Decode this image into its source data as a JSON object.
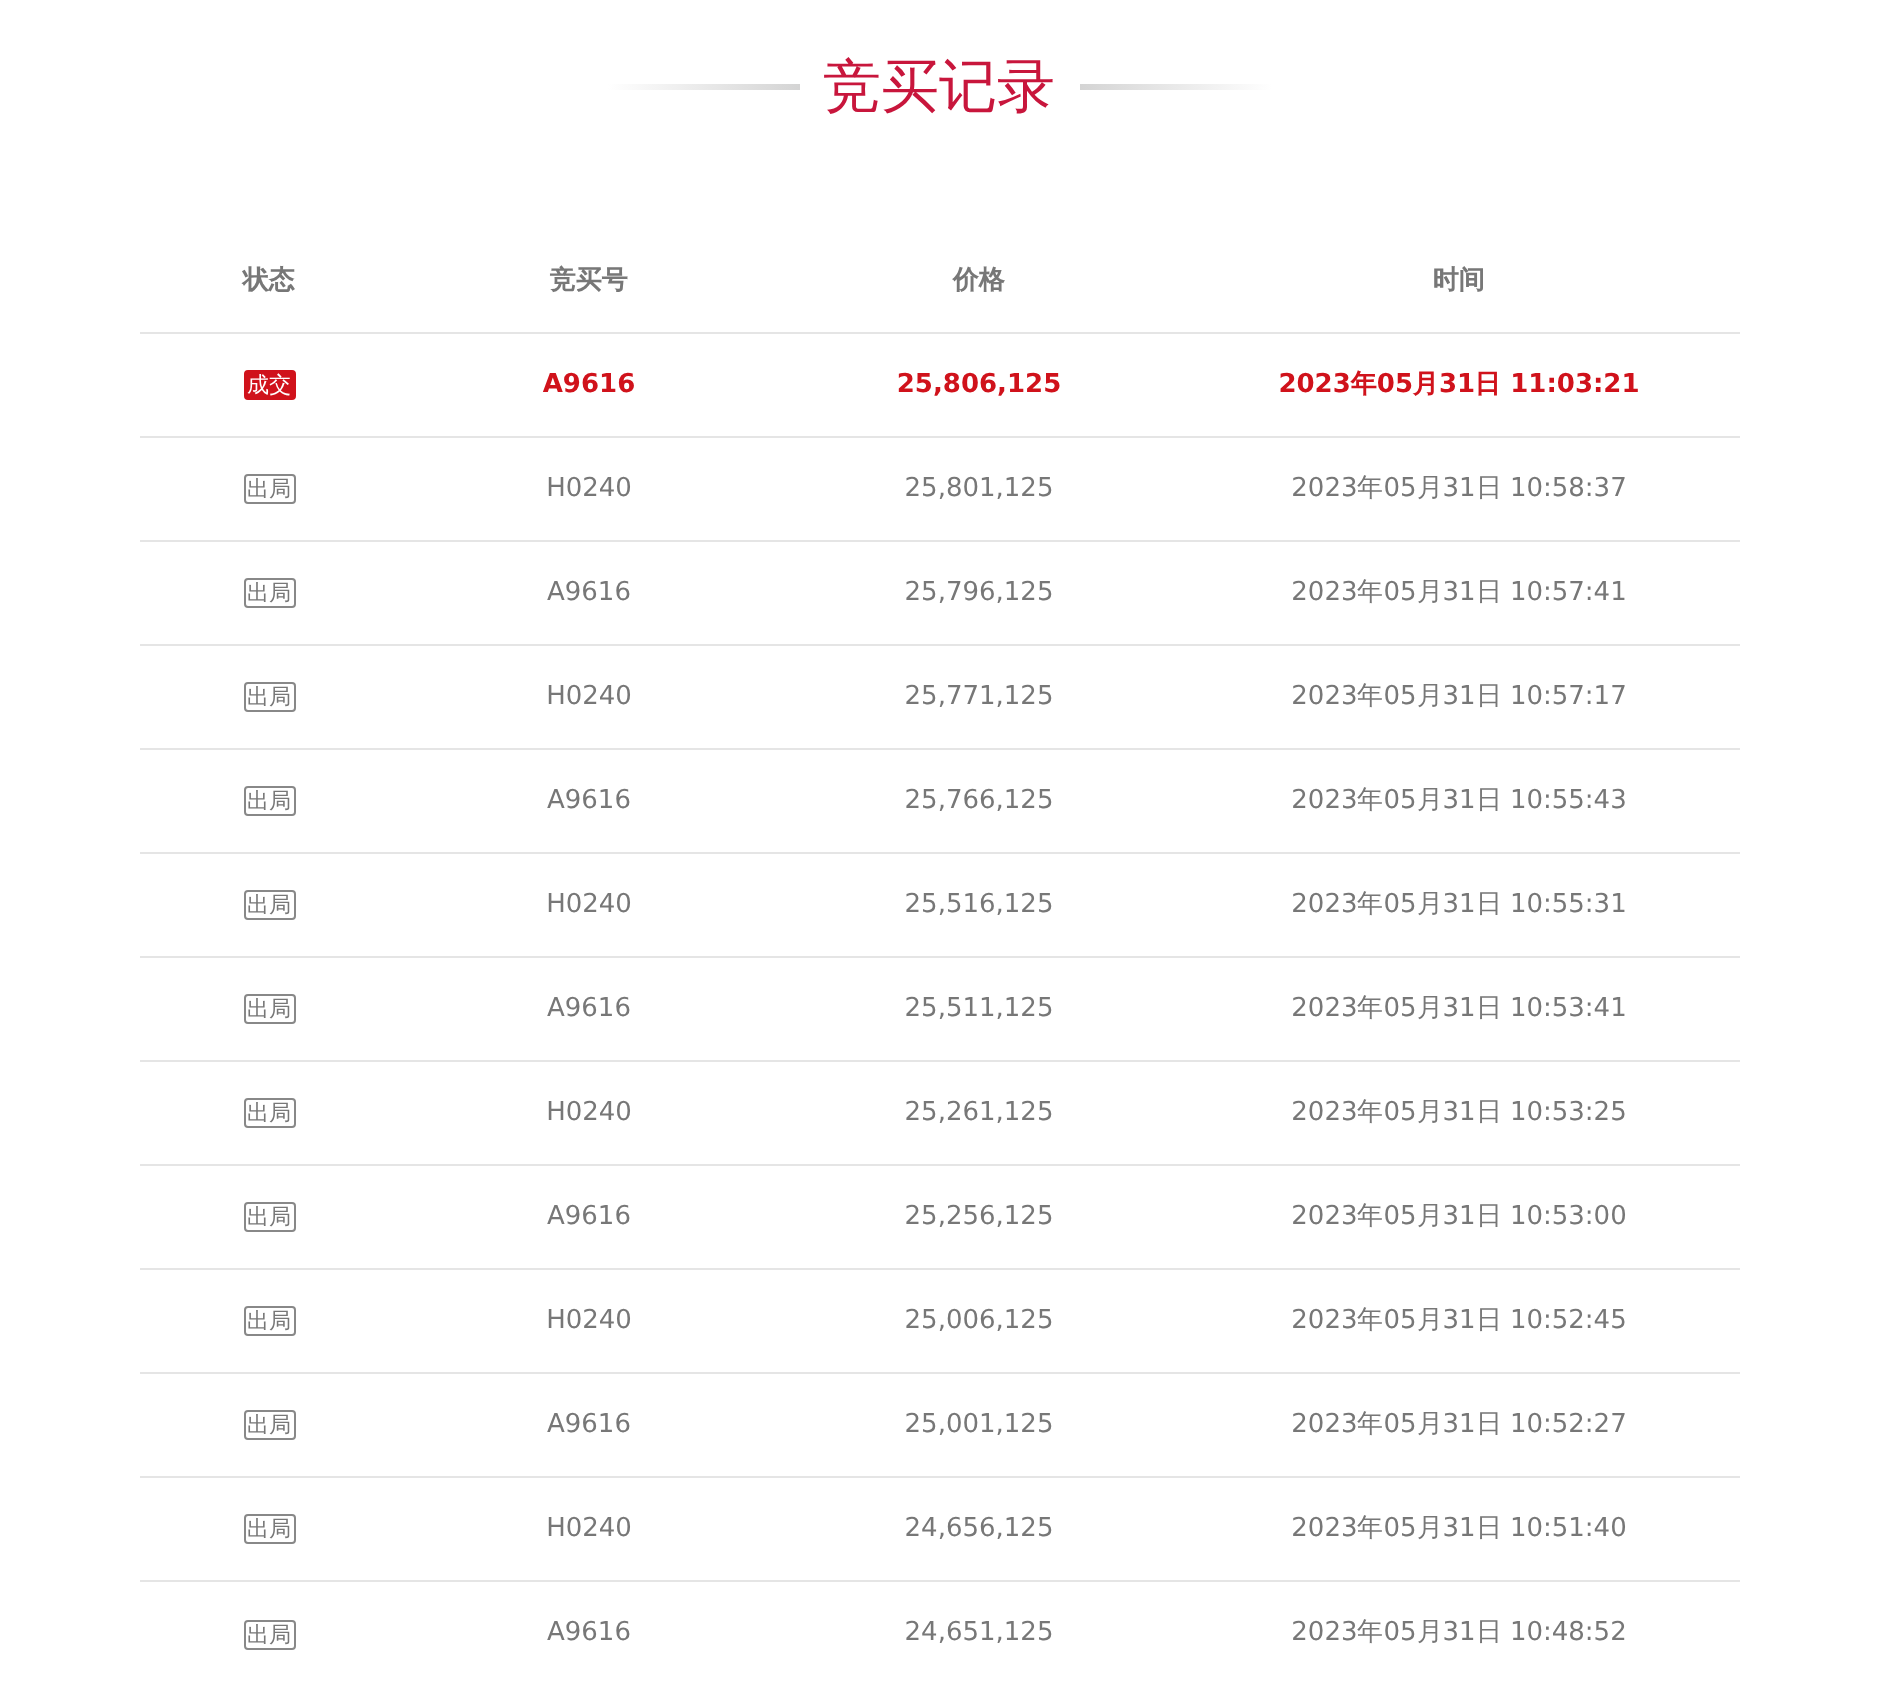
{
  "title": "竞买记录",
  "table": {
    "columns": [
      "状态",
      "竞买号",
      "价格",
      "时间"
    ],
    "rows": [
      {
        "kind": "deal",
        "status": "成交",
        "bidder": "A9616",
        "price": "25,806,125",
        "time": "2023年05月31日 11:03:21"
      },
      {
        "kind": "out",
        "status": "出局",
        "bidder": "H0240",
        "price": "25,801,125",
        "time": "2023年05月31日 10:58:37"
      },
      {
        "kind": "out",
        "status": "出局",
        "bidder": "A9616",
        "price": "25,796,125",
        "time": "2023年05月31日 10:57:41"
      },
      {
        "kind": "out",
        "status": "出局",
        "bidder": "H0240",
        "price": "25,771,125",
        "time": "2023年05月31日 10:57:17"
      },
      {
        "kind": "out",
        "status": "出局",
        "bidder": "A9616",
        "price": "25,766,125",
        "time": "2023年05月31日 10:55:43"
      },
      {
        "kind": "out",
        "status": "出局",
        "bidder": "H0240",
        "price": "25,516,125",
        "time": "2023年05月31日 10:55:31"
      },
      {
        "kind": "out",
        "status": "出局",
        "bidder": "A9616",
        "price": "25,511,125",
        "time": "2023年05月31日 10:53:41"
      },
      {
        "kind": "out",
        "status": "出局",
        "bidder": "H0240",
        "price": "25,261,125",
        "time": "2023年05月31日 10:53:25"
      },
      {
        "kind": "out",
        "status": "出局",
        "bidder": "A9616",
        "price": "25,256,125",
        "time": "2023年05月31日 10:53:00"
      },
      {
        "kind": "out",
        "status": "出局",
        "bidder": "H0240",
        "price": "25,006,125",
        "time": "2023年05月31日 10:52:45"
      },
      {
        "kind": "out",
        "status": "出局",
        "bidder": "A9616",
        "price": "25,001,125",
        "time": "2023年05月31日 10:52:27"
      },
      {
        "kind": "out",
        "status": "出局",
        "bidder": "H0240",
        "price": "24,656,125",
        "time": "2023年05月31日 10:51:40"
      },
      {
        "kind": "out",
        "status": "出局",
        "bidder": "A9616",
        "price": "24,651,125",
        "time": "2023年05月31日 10:48:52"
      }
    ]
  }
}
